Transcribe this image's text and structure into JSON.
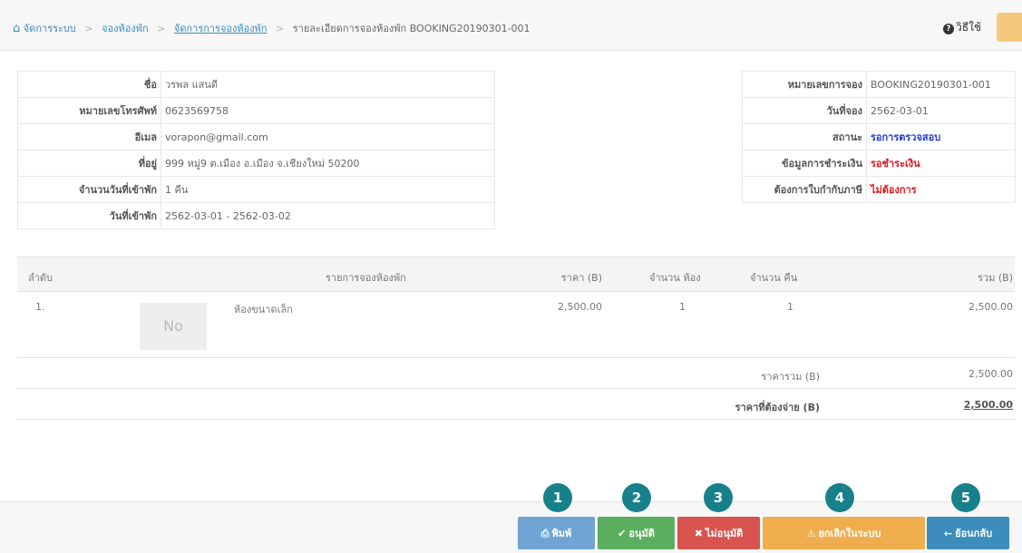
{
  "breadcrumb": {
    "items": [
      "จัดการระบบ",
      "จองห้องพัก",
      "จัดการการจองห้องพัก"
    ],
    "current": "รายละเอียดการจองห้องพัก BOOKING20190301-001"
  },
  "header": {
    "help_label": "วิธีใช้"
  },
  "customer": {
    "rows": [
      {
        "label": "ชื่อ",
        "value": "วรพล แสนดี"
      },
      {
        "label": "หมายเลขโทรศัพท์",
        "value": "0623569758"
      },
      {
        "label": "อีเมล",
        "value": "vorapon@gmail.com"
      },
      {
        "label": "ที่อยู่",
        "value": "999 หมู่9 ต.เมือง อ.เมือง จ.เชียงใหม่ 50200"
      },
      {
        "label": "จำนวนวันที่เข้าพัก",
        "value": "1 คืน"
      },
      {
        "label": "วันที่เข้าพัก",
        "value": "2562-03-01 - 2562-03-02"
      }
    ]
  },
  "booking": {
    "rows": [
      {
        "label": "หมายเลขการจอง",
        "value": "BOOKING20190301-001"
      },
      {
        "label": "วันที่จอง",
        "value": "2562-03-01"
      },
      {
        "label": "สถานะ",
        "value": "รอการตรวจสอบ"
      },
      {
        "label": "ข้อมูลการชำระเงิน",
        "value": "รอชำระเงิน"
      },
      {
        "label": "ต้องการใบกำกับภาษี",
        "value": "ไม่ต้องการ"
      }
    ],
    "status_color": "#1f3bd8",
    "alert_color": "#e0161b"
  },
  "items_table": {
    "headers": [
      "ลำดับ",
      "รายการจองห้องพัก",
      "ราคา (B)",
      "จำนวน ห้อง",
      "จำนวน คืน",
      "รวม (B)"
    ],
    "rows": [
      {
        "no": "1.",
        "image": "No",
        "name": "ห้องขนาดเล็ก",
        "price": "2,500.00",
        "rooms": "1",
        "nights": "1",
        "total": "2,500.00"
      }
    ],
    "subtotal_label": "ราคารวม (B)",
    "subtotal_value": "2,500.00",
    "grand_label": "ราคาที่ต้องจ่าย (B)",
    "grand_value": "2,500.00"
  },
  "actions": [
    {
      "num": "1",
      "label": "พิมพ์",
      "icon": "printer-icon",
      "color": "#6fa4d4"
    },
    {
      "num": "2",
      "label": "อนุมัติ",
      "icon": "check-icon",
      "color": "#5cae5f"
    },
    {
      "num": "3",
      "label": "ไม่อนุมัติ",
      "icon": "times-icon",
      "color": "#d9534f"
    },
    {
      "num": "4",
      "label": "ยกเลิกในระบบ",
      "icon": "warning-icon",
      "color": "#f0ad4e"
    },
    {
      "num": "5",
      "label": "ย้อนกลับ",
      "icon": "arrow-left-icon",
      "color": "#3c8dbc"
    }
  ]
}
